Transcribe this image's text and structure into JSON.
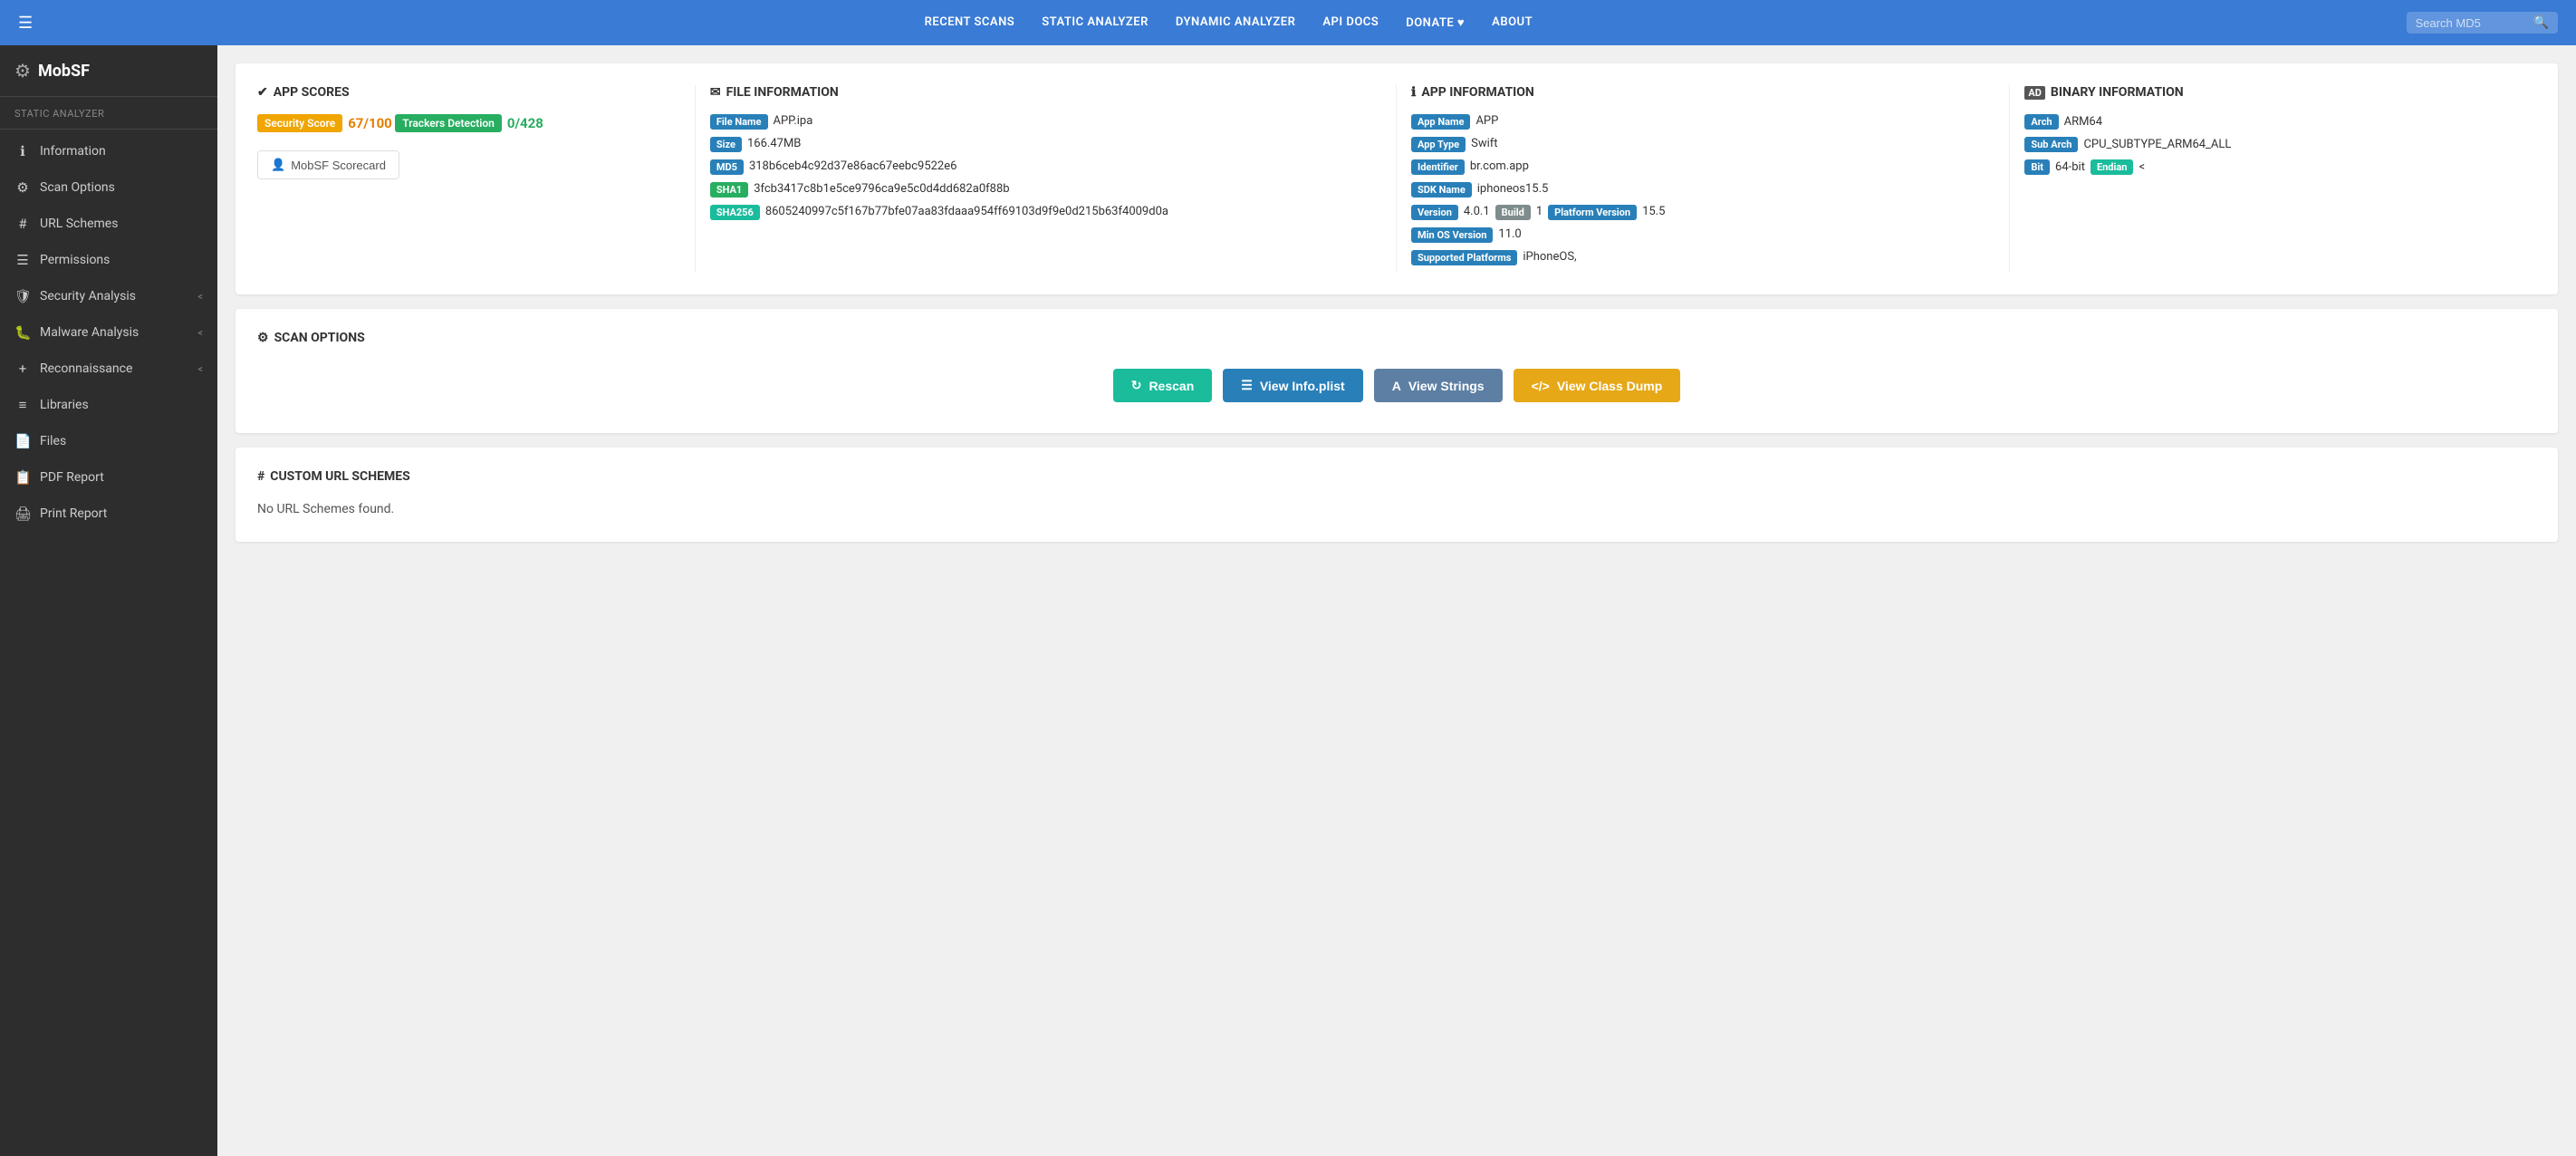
{
  "brand": {
    "icon": "⚙",
    "name": "MobSF"
  },
  "topnav": {
    "menu_icon": "☰",
    "links": [
      "RECENT SCANS",
      "STATIC ANALYZER",
      "DYNAMIC ANALYZER",
      "API DOCS",
      "DONATE ♥",
      "ABOUT"
    ],
    "search_placeholder": "Search MD5"
  },
  "sidebar": {
    "section_label": "Static Analyzer",
    "items": [
      {
        "icon": "ℹ",
        "label": "Information",
        "arrow": ""
      },
      {
        "icon": "⚙",
        "label": "Scan Options",
        "arrow": ""
      },
      {
        "icon": "#",
        "label": "URL Schemes",
        "arrow": ""
      },
      {
        "icon": "☰",
        "label": "Permissions",
        "arrow": ""
      },
      {
        "icon": "🛡",
        "label": "Security Analysis",
        "arrow": "<"
      },
      {
        "icon": "🐛",
        "label": "Malware Analysis",
        "arrow": "<"
      },
      {
        "icon": "+",
        "label": "Reconnaissance",
        "arrow": "<"
      },
      {
        "icon": "≡",
        "label": "Libraries",
        "arrow": ""
      },
      {
        "icon": "📄",
        "label": "Files",
        "arrow": ""
      },
      {
        "icon": "📋",
        "label": "PDF Report",
        "arrow": ""
      },
      {
        "icon": "🖨",
        "label": "Print Report",
        "arrow": ""
      }
    ]
  },
  "app_scores": {
    "section_icon": "✔",
    "section_title": "APP SCORES",
    "security_score_label": "Security Score",
    "security_score_value": "67/100",
    "trackers_label": "Trackers Detection",
    "trackers_value": "0/428",
    "scorecard_btn": "MobSF Scorecard"
  },
  "file_info": {
    "section_icon": "✉",
    "section_title": "FILE INFORMATION",
    "rows": [
      {
        "badge": "File Name",
        "badge_class": "badge-blue",
        "value": "APP.ipa"
      },
      {
        "badge": "Size",
        "badge_class": "badge-blue",
        "value": "166.47MB"
      },
      {
        "badge": "MD5",
        "badge_class": "badge-blue",
        "value": "318b6ceb4c92d37e86ac67eebc9522e6"
      },
      {
        "badge": "SHA1",
        "badge_class": "badge-green",
        "value": "3fcb3417c8b1e5ce9796ca9e5c0d4dd682a0f88b"
      },
      {
        "badge": "SHA256",
        "badge_class": "badge-teal",
        "value": "8605240997c5f167b77bfe07aa83fdaaa954ff69103d9f9e0d215b63f4009d0a"
      }
    ]
  },
  "app_info": {
    "section_icon": "ℹ",
    "section_title": "APP INFORMATION",
    "rows": [
      {
        "badge": "App Name",
        "badge_class": "badge-blue",
        "value": "APP"
      },
      {
        "badge": "App Type",
        "badge_class": "badge-blue",
        "value": "Swift"
      },
      {
        "badge": "Identifier",
        "badge_class": "badge-blue",
        "value": "br.com.app"
      },
      {
        "badge": "SDK Name",
        "badge_class": "badge-blue",
        "value": "iphoneos15.5"
      },
      {
        "badge_multi": true,
        "items": [
          {
            "badge": "Version",
            "badge_class": "badge-blue",
            "value": "4.0.1"
          },
          {
            "badge": "Build",
            "badge_class": "badge-gray",
            "value": "1"
          },
          {
            "badge": "Platform Version",
            "badge_class": "badge-blue",
            "value": "15.5"
          }
        ]
      },
      {
        "badge": "Min OS Version",
        "badge_class": "badge-blue",
        "value": "11.0"
      },
      {
        "badge": "Supported Platforms",
        "badge_class": "badge-blue",
        "value": "iPhoneOS,"
      }
    ]
  },
  "binary_info": {
    "section_icon": "Ad",
    "section_title": "BINARY INFORMATION",
    "rows": [
      {
        "badge": "Arch",
        "badge_class": "badge-blue",
        "value": "ARM64"
      },
      {
        "badge": "Sub Arch",
        "badge_class": "badge-blue",
        "value": "CPU_SUBTYPE_ARM64_ALL"
      },
      {
        "badge1": "Bit",
        "badge_class1": "badge-blue",
        "value1": "64-bit",
        "badge2": "Endian",
        "badge_class2": "badge-teal",
        "value2": "<"
      }
    ]
  },
  "scan_options": {
    "section_icon": "⚙",
    "section_title": "SCAN OPTIONS",
    "buttons": [
      {
        "icon": "↻",
        "label": "Rescan",
        "class": "btn-teal"
      },
      {
        "icon": "☰",
        "label": "View Info.plist",
        "class": "btn-blue"
      },
      {
        "icon": "A",
        "label": "View Strings",
        "class": "btn-steel"
      },
      {
        "icon": "</>",
        "label": "View Class Dump",
        "class": "btn-gold"
      }
    ]
  },
  "url_schemes": {
    "section_icon": "#",
    "section_title": "CUSTOM URL SCHEMES",
    "empty_text": "No URL Schemes found."
  }
}
